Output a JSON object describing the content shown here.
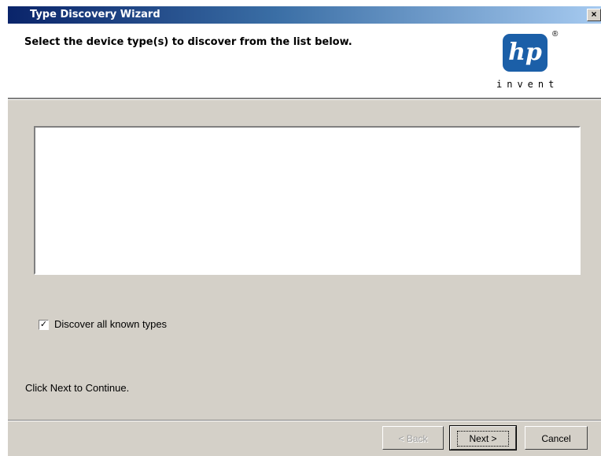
{
  "window": {
    "title": "Type Discovery Wizard",
    "close_glyph": "×"
  },
  "header": {
    "instruction": "Select the device type(s) to discover from the list below.",
    "logo": {
      "mark": "hp",
      "registered": "®",
      "tagline": "invent",
      "color": "#1b5fa8"
    }
  },
  "body": {
    "device_list_items": [],
    "discover_all": {
      "label": "Discover all known types",
      "checked": true,
      "check_glyph": "✓"
    },
    "hint": "Click Next to Continue."
  },
  "buttons": {
    "back": "< Back",
    "next": "Next >",
    "cancel": "Cancel"
  },
  "colors": {
    "titlebar_start": "#0a246a",
    "titlebar_end": "#a6caf0",
    "dialog_face": "#d4d0c8"
  }
}
